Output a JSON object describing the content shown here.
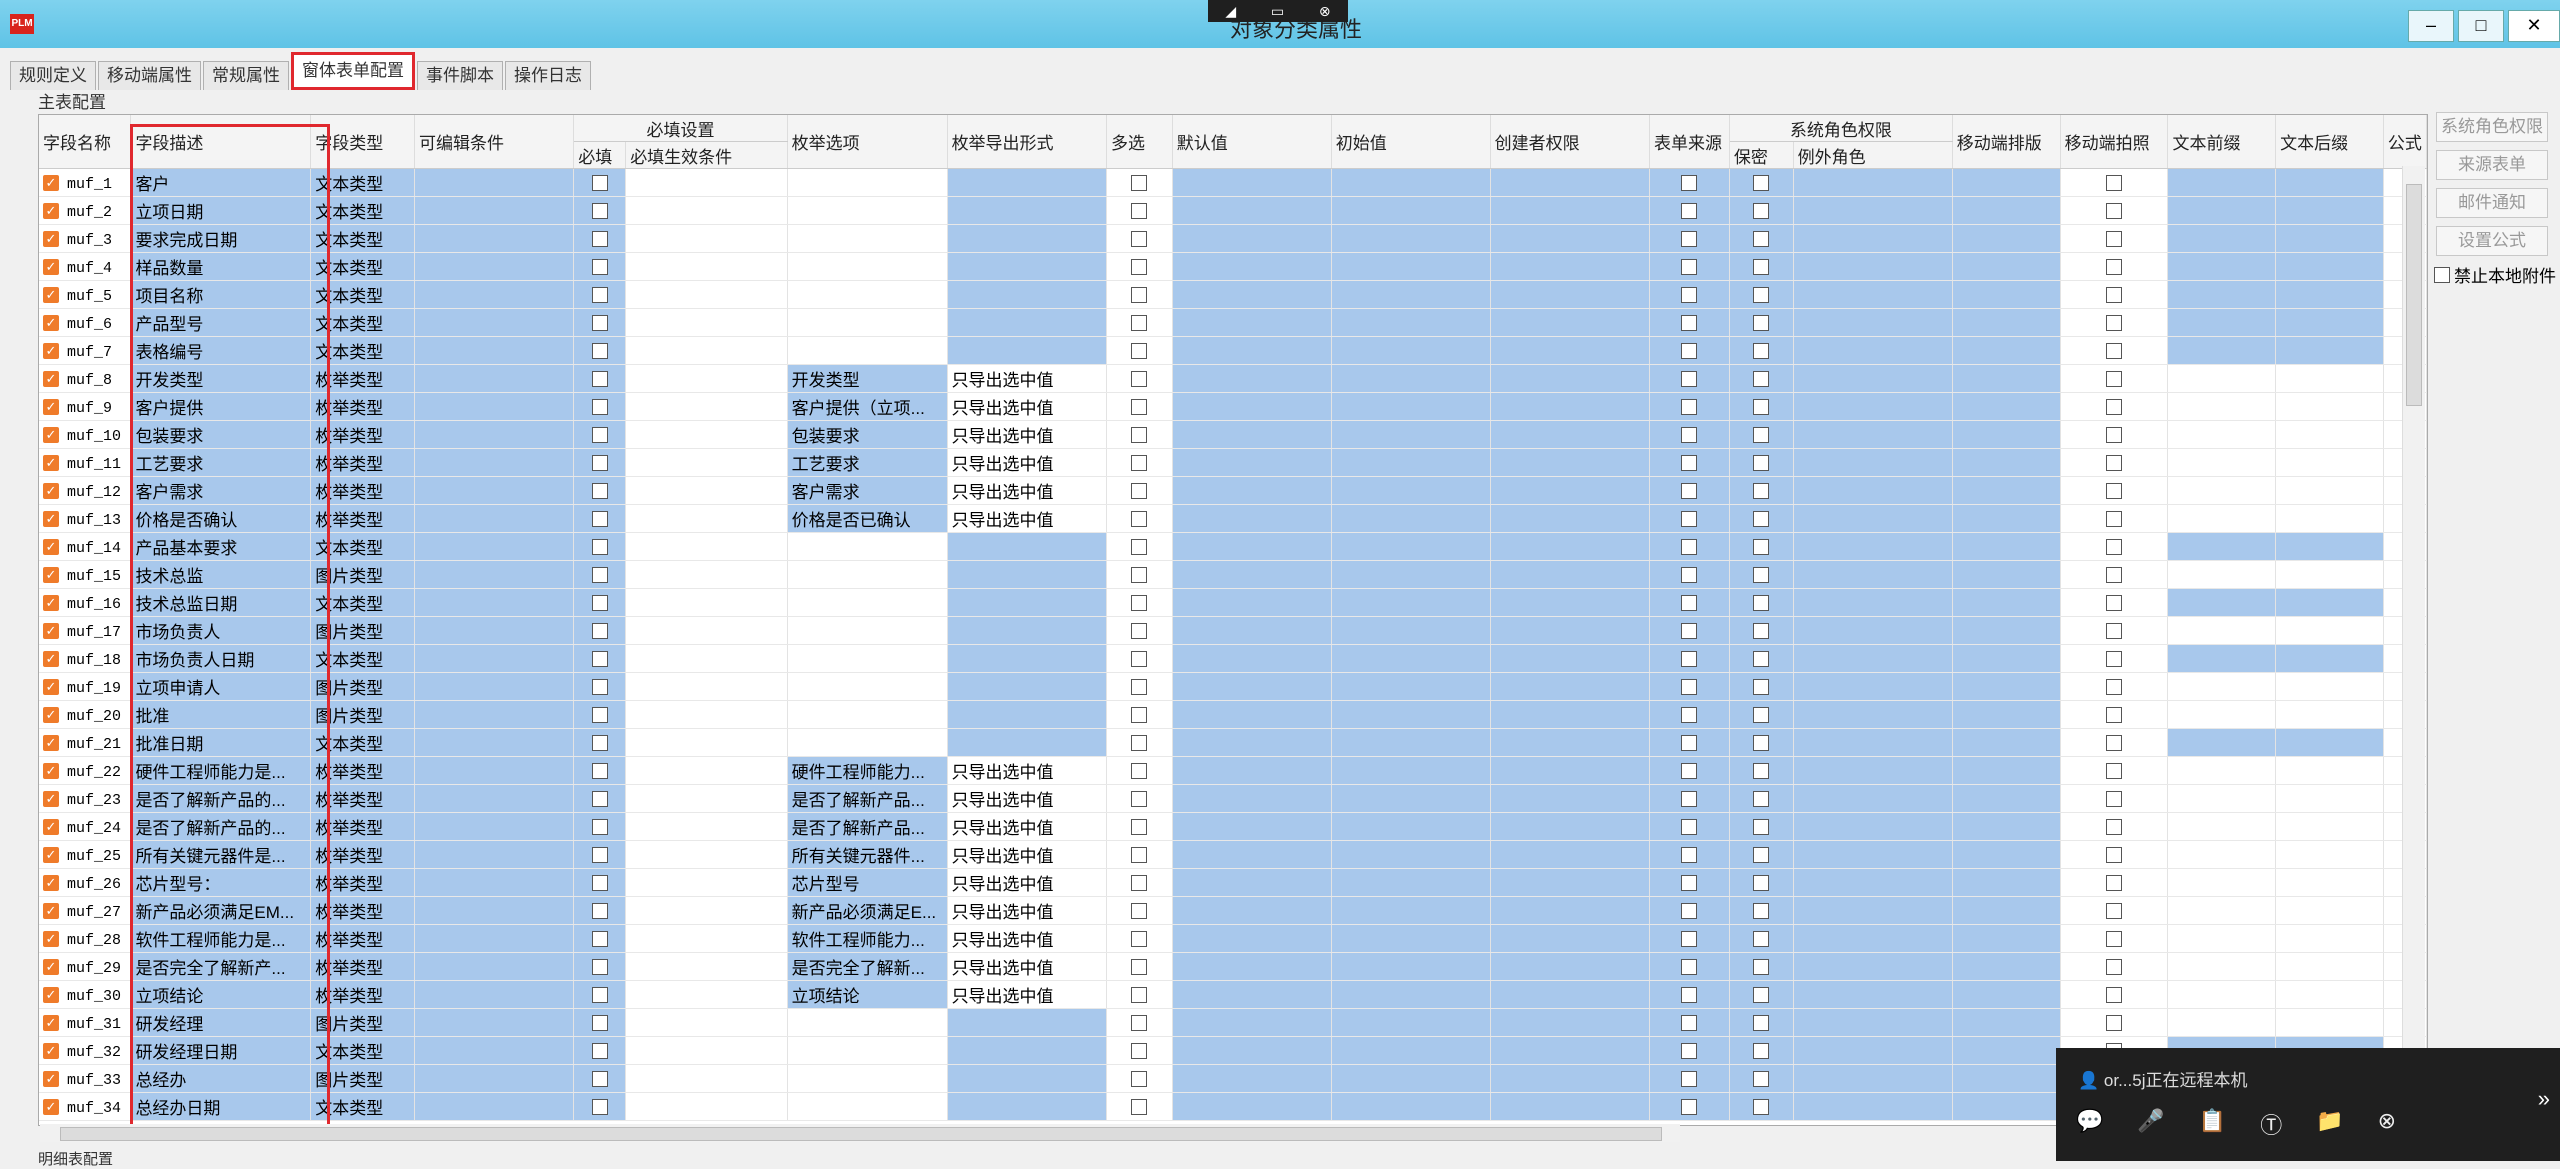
{
  "window": {
    "title": "对象分类属性",
    "icon_text": "PLM"
  },
  "remote_toolbar": {
    "icons": [
      "pin-icon",
      "minimize-icon",
      "close-icon"
    ]
  },
  "tabs": [
    "规则定义",
    "移动端属性",
    "常规属性",
    "窗体表单配置",
    "事件脚本",
    "操作日志"
  ],
  "active_tab": "窗体表单配置",
  "section_label": "主表配置",
  "headers": {
    "field_name": "字段名称",
    "field_desc": "字段描述",
    "field_type": "字段类型",
    "editable_cond": "可编辑条件",
    "required_group": "必填设置",
    "required": "必填",
    "required_cond": "必填生效条件",
    "enum_option": "枚举选项",
    "enum_export": "枚举导出形式",
    "multi": "多选",
    "default_value": "默认值",
    "initial_value": "初始值",
    "creator_perm": "创建者权限",
    "form_source": "表单来源",
    "sys_role_group": "系统角色权限",
    "secret": "保密",
    "exception_role": "例外角色",
    "mobile_layout": "移动端排版",
    "mobile_photo": "移动端拍照",
    "text_prefix": "文本前缀",
    "text_suffix": "文本后缀",
    "formula": "公式"
  },
  "rows": [
    {
      "name": "muf_1",
      "desc": "客户",
      "type": "文本类型",
      "enum": "",
      "export": ""
    },
    {
      "name": "muf_2",
      "desc": "立项日期",
      "type": "文本类型",
      "enum": "",
      "export": ""
    },
    {
      "name": "muf_3",
      "desc": "要求完成日期",
      "type": "文本类型",
      "enum": "",
      "export": ""
    },
    {
      "name": "muf_4",
      "desc": "样品数量",
      "type": "文本类型",
      "enum": "",
      "export": ""
    },
    {
      "name": "muf_5",
      "desc": "项目名称",
      "type": "文本类型",
      "enum": "",
      "export": ""
    },
    {
      "name": "muf_6",
      "desc": "产品型号",
      "type": "文本类型",
      "enum": "",
      "export": ""
    },
    {
      "name": "muf_7",
      "desc": "表格编号",
      "type": "文本类型",
      "enum": "",
      "export": ""
    },
    {
      "name": "muf_8",
      "desc": "开发类型",
      "type": "枚举类型",
      "enum": "开发类型",
      "export": "只导出选中值"
    },
    {
      "name": "muf_9",
      "desc": "客户提供",
      "type": "枚举类型",
      "enum": "客户提供（立项...",
      "export": "只导出选中值"
    },
    {
      "name": "muf_10",
      "desc": "包装要求",
      "type": "枚举类型",
      "enum": "包装要求",
      "export": "只导出选中值"
    },
    {
      "name": "muf_11",
      "desc": "工艺要求",
      "type": "枚举类型",
      "enum": "工艺要求",
      "export": "只导出选中值"
    },
    {
      "name": "muf_12",
      "desc": "客户需求",
      "type": "枚举类型",
      "enum": "客户需求",
      "export": "只导出选中值"
    },
    {
      "name": "muf_13",
      "desc": "价格是否确认",
      "type": "枚举类型",
      "enum": "价格是否已确认",
      "export": "只导出选中值"
    },
    {
      "name": "muf_14",
      "desc": "产品基本要求",
      "type": "文本类型",
      "enum": "",
      "export": ""
    },
    {
      "name": "muf_15",
      "desc": "技术总监",
      "type": "图片类型",
      "enum": "",
      "export": ""
    },
    {
      "name": "muf_16",
      "desc": "技术总监日期",
      "type": "文本类型",
      "enum": "",
      "export": ""
    },
    {
      "name": "muf_17",
      "desc": "市场负责人",
      "type": "图片类型",
      "enum": "",
      "export": ""
    },
    {
      "name": "muf_18",
      "desc": "市场负责人日期",
      "type": "文本类型",
      "enum": "",
      "export": ""
    },
    {
      "name": "muf_19",
      "desc": "立项申请人",
      "type": "图片类型",
      "enum": "",
      "export": ""
    },
    {
      "name": "muf_20",
      "desc": "批准",
      "type": "图片类型",
      "enum": "",
      "export": ""
    },
    {
      "name": "muf_21",
      "desc": "批准日期",
      "type": "文本类型",
      "enum": "",
      "export": ""
    },
    {
      "name": "muf_22",
      "desc": "硬件工程师能力是...",
      "type": "枚举类型",
      "enum": "硬件工程师能力...",
      "export": "只导出选中值"
    },
    {
      "name": "muf_23",
      "desc": "是否了解新产品的...",
      "type": "枚举类型",
      "enum": "是否了解新产品...",
      "export": "只导出选中值"
    },
    {
      "name": "muf_24",
      "desc": "是否了解新产品的...",
      "type": "枚举类型",
      "enum": "是否了解新产品...",
      "export": "只导出选中值"
    },
    {
      "name": "muf_25",
      "desc": "所有关键元器件是...",
      "type": "枚举类型",
      "enum": "所有关键元器件...",
      "export": "只导出选中值"
    },
    {
      "name": "muf_26",
      "desc": "芯片型号：",
      "type": "枚举类型",
      "enum": "芯片型号",
      "export": "只导出选中值"
    },
    {
      "name": "muf_27",
      "desc": "新产品必须满足EM...",
      "type": "枚举类型",
      "enum": "新产品必须满足E...",
      "export": "只导出选中值"
    },
    {
      "name": "muf_28",
      "desc": "软件工程师能力是...",
      "type": "枚举类型",
      "enum": "软件工程师能力...",
      "export": "只导出选中值"
    },
    {
      "name": "muf_29",
      "desc": "是否完全了解新产...",
      "type": "枚举类型",
      "enum": "是否完全了解新...",
      "export": "只导出选中值"
    },
    {
      "name": "muf_30",
      "desc": "立项结论",
      "type": "枚举类型",
      "enum": "立项结论",
      "export": "只导出选中值"
    },
    {
      "name": "muf_31",
      "desc": "研发经理",
      "type": "图片类型",
      "enum": "",
      "export": ""
    },
    {
      "name": "muf_32",
      "desc": "研发经理日期",
      "type": "文本类型",
      "enum": "",
      "export": ""
    },
    {
      "name": "muf_33",
      "desc": "总经办",
      "type": "图片类型",
      "enum": "",
      "export": ""
    },
    {
      "name": "muf_34",
      "desc": "总经办日期",
      "type": "文本类型",
      "enum": "",
      "export": ""
    }
  ],
  "side_buttons": [
    "系统角色权限",
    "来源表单",
    "邮件通知",
    "设置公式"
  ],
  "side_checkbox": "禁止本地附件",
  "bottom_label": "明细表配置",
  "remote_panel": {
    "message": "or...5j正在远程本机",
    "icons": [
      "chat-icon",
      "microphone-icon",
      "clipboard-icon",
      "text-icon",
      "file-transfer-icon",
      "disconnect-icon"
    ]
  },
  "colors": {
    "accent_red": "#e0282e",
    "cell_blue": "#a8c8ec",
    "check_orange": "#ef7b2a",
    "titlebar": "#6ccbeb"
  }
}
